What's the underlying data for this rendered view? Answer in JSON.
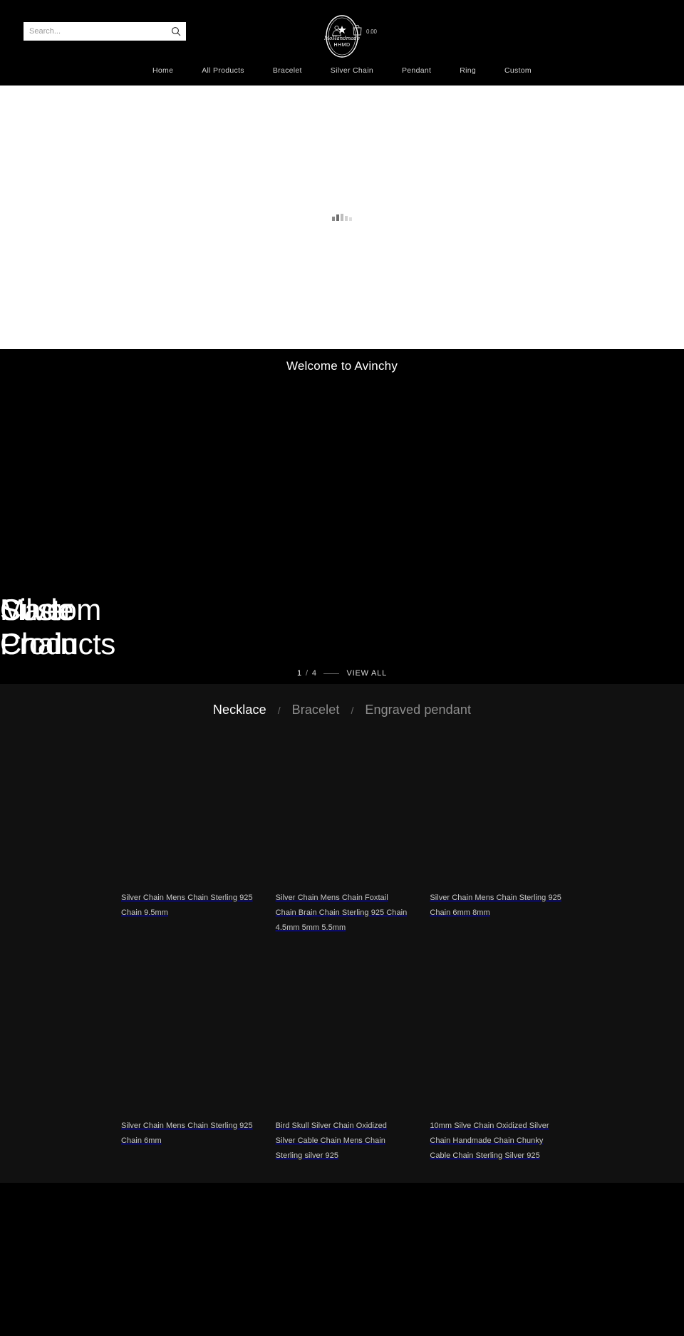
{
  "header": {
    "search": {
      "placeholder": "Search...",
      "value": "",
      "icon": "search-icon"
    },
    "logo": {
      "brand_line1": "MoHandmade",
      "brand_line2": "HHMD",
      "alt": "Avinchy handmade logo"
    },
    "account_icon": "account-person-icon",
    "cart_icon": "shopping-bag-icon",
    "cart_price": "0.00",
    "cart_currency_prefix": "₺"
  },
  "nav": {
    "items": [
      {
        "label": "Home"
      },
      {
        "label": "All Products"
      },
      {
        "label": "Bracelet"
      },
      {
        "label": "Silver Chain"
      },
      {
        "label": "Pendant"
      },
      {
        "label": "Ring"
      },
      {
        "label": "Custom"
      }
    ]
  },
  "hero": {
    "loading_indicator": "loading-bars-icon"
  },
  "welcome": {
    "heading": "Welcome to Avinchy"
  },
  "slider": {
    "slides": [
      {
        "title": "Silver\nChain"
      },
      {
        "title": "Custom\nProducts"
      },
      {
        "title": "Made\n"
      }
    ],
    "current": "1",
    "total": "4",
    "separator": "/",
    "view_all_label": "VIEW ALL"
  },
  "categories": {
    "tabs": [
      {
        "label": "Necklace",
        "active": true
      },
      {
        "label": "Bracelet",
        "active": false
      },
      {
        "label": "Engraved pendant",
        "active": false
      }
    ],
    "separator": "/"
  },
  "products": [
    {
      "title": "Silver Chain Mens Chain Sterling 925 Chain 9.5mm"
    },
    {
      "title": "Silver Chain Mens Chain Foxtail Chain Brain Chain Sterling 925 Chain 4.5mm 5mm 5.5mm"
    },
    {
      "title": "Silver Chain Mens Chain Sterling 925 Chain 6mm 8mm"
    },
    {
      "title": "Silver Chain Mens Chain Sterling 925 Chain 6mm"
    },
    {
      "title": "Bird Skull Silver Chain Oxidized Silver Cable Chain Mens Chain Sterling silver 925"
    },
    {
      "title": "10mm Silve Chain Oxidized Silver Chain Handmade Chain Chunky Cable Chain Sterling Silver 925"
    }
  ],
  "colors": {
    "page_bg": "#000000",
    "section_bg": "#111111",
    "hero_bg": "#ffffff",
    "text_primary": "#ffffff",
    "text_muted": "#8d8d8d",
    "text_body": "#c9c9c9"
  }
}
